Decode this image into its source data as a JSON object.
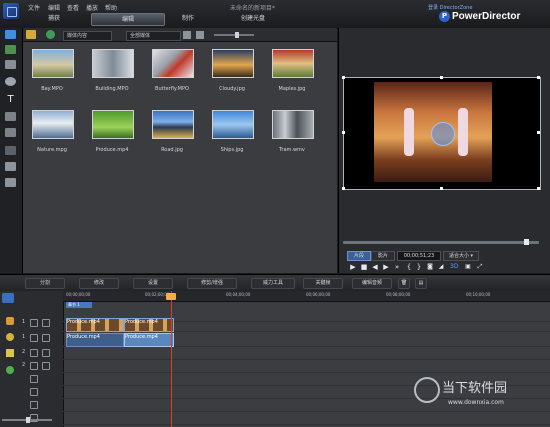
{
  "menu": [
    "文件",
    "编辑",
    "查看",
    "播放",
    "帮助"
  ],
  "project_title": "未命名的新项目*",
  "zone_link": "登录 DirectorZone",
  "brand": "PowerDirector",
  "brand_icon": "power-director-logo",
  "tabs": [
    "捕获",
    "编辑",
    "制作",
    "创建光盘"
  ],
  "library": {
    "content_dropdown": "媒体内容",
    "filter_dropdown": "全部媒体",
    "items": [
      {
        "label": "Bay.MPO"
      },
      {
        "label": "Building.MPO"
      },
      {
        "label": "Butterfly.MPO"
      },
      {
        "label": "Cloudy.jpg"
      },
      {
        "label": "Maples.jpg"
      },
      {
        "label": "Nature.mpg"
      },
      {
        "label": "Produce.mp4"
      },
      {
        "label": "Road.jpg"
      },
      {
        "label": "Ships.jpg"
      },
      {
        "label": "Tram.wmv"
      }
    ]
  },
  "preview": {
    "mode_clip": "片段",
    "mode_movie": "影片",
    "timecode": "00;00;51;23",
    "fit_label": "适合大小 ▾",
    "vol_label": "3D"
  },
  "toolbar": [
    "分割",
    "修改",
    "设置",
    "修剪/增强",
    "威力工具",
    "关键帧",
    "编辑音频"
  ],
  "ruler": [
    "00;00;00;00",
    "00;02;00;00",
    "00;04;00;00",
    "00;06;00;00",
    "00;08;00;00",
    "00;10;00;00"
  ],
  "timeline": {
    "marker_label": "章节 1",
    "clip_video_1": "Produce.mp4",
    "clip_video_2": "Produce.mp4",
    "clip_audio_1": "Produce.mp4",
    "clip_audio_2": "Produce.mp4",
    "track_numbers": [
      "1",
      "1",
      "2",
      "2"
    ]
  },
  "watermark": {
    "title": "当下软件园",
    "url": "www.downxia.com"
  },
  "colors": {
    "accent": "#2b63c9",
    "playhead": "#e03a2a",
    "clip_border": "#7fa6d4"
  }
}
